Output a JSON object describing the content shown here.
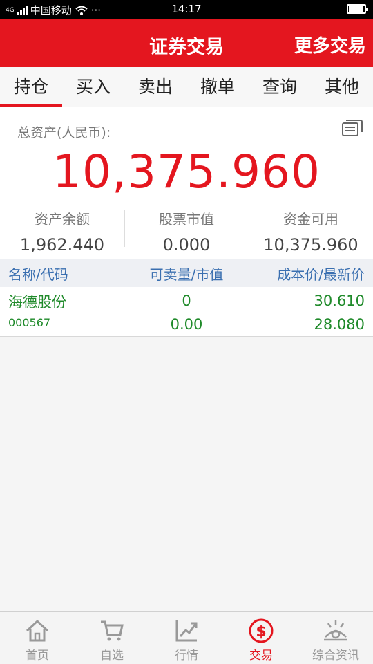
{
  "status_bar": {
    "signal_label": "4G",
    "carrier": "中国移动",
    "more_dots": "···",
    "time": "14:17",
    "battery_level": 0.95
  },
  "header": {
    "title": "证券交易",
    "more_label": "更多交易"
  },
  "tabs": [
    {
      "label": "持仓",
      "active": true
    },
    {
      "label": "买入",
      "active": false
    },
    {
      "label": "卖出",
      "active": false
    },
    {
      "label": "撤单",
      "active": false
    },
    {
      "label": "查询",
      "active": false
    },
    {
      "label": "其他",
      "active": false
    }
  ],
  "assets": {
    "total_label": "总资产(人民币):",
    "total_value": "10,375.960",
    "metrics": [
      {
        "label": "资产余额",
        "value": "1,962.440"
      },
      {
        "label": "股票市值",
        "value": "0.000"
      },
      {
        "label": "资金可用",
        "value": "10,375.960"
      }
    ]
  },
  "holdings_table": {
    "headers": [
      "名称/代码",
      "可卖量/市值",
      "成本价/最新价"
    ],
    "rows": [
      {
        "name": "海德股份",
        "code": "000567",
        "sellable_qty": "0",
        "market_value": "0.00",
        "cost_price": "30.610",
        "latest_price": "28.080"
      }
    ]
  },
  "bottom_nav": [
    {
      "label": "首页",
      "icon": "home-icon",
      "active": false
    },
    {
      "label": "自选",
      "icon": "cart-icon",
      "active": false
    },
    {
      "label": "行情",
      "icon": "trend-chart-icon",
      "active": false
    },
    {
      "label": "交易",
      "icon": "dollar-circle-icon",
      "active": true
    },
    {
      "label": "综合资讯",
      "icon": "eye-radiant-icon",
      "active": false
    }
  ],
  "colors": {
    "brand_red": "#e4161f",
    "gain_green": "#1f8a2a",
    "header_blue": "#3a6fb0"
  }
}
